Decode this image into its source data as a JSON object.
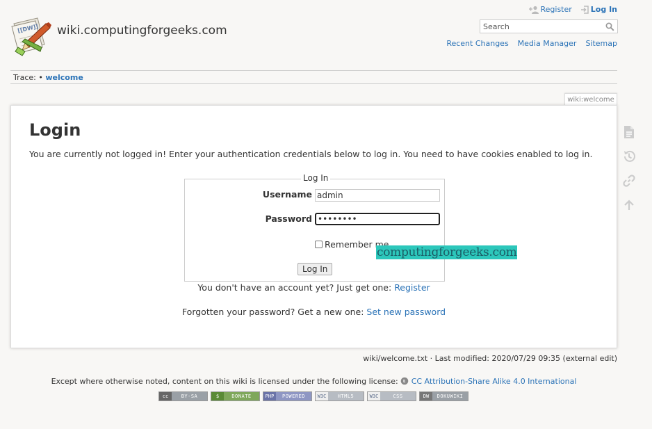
{
  "header": {
    "site_title": "wiki.computingforgeeks.com",
    "logo_text": "[[DW]]"
  },
  "user_tools": {
    "register": "Register",
    "login": "Log In"
  },
  "search": {
    "placeholder": "Search",
    "value": ""
  },
  "site_tools": {
    "recent_changes": "Recent Changes",
    "media_manager": "Media Manager",
    "sitemap": "Sitemap"
  },
  "breadcrumbs": {
    "label": "Trace:",
    "separator": "•",
    "items": [
      "welcome"
    ]
  },
  "page_id": "wiki:welcome",
  "page": {
    "title": "Login",
    "intro": "You are currently not logged in! Enter your authentication credentials below to log in. You need to have cookies enabled to log in."
  },
  "login_form": {
    "legend": "Log In",
    "username_label": "Username",
    "username_value": "admin",
    "password_label": "Password",
    "password_value": "********",
    "remember_label": "Remember me",
    "remember_checked": false,
    "submit_label": "Log In"
  },
  "watermark": "computingforgeeks.com",
  "no_account": {
    "text": "You don't have an account yet? Just get one:",
    "link": "Register"
  },
  "forgot": {
    "text": "Forgotten your password? Get a new one:",
    "link": "Set new password"
  },
  "page_tools": [
    "show-page-icon",
    "old-revisions-icon",
    "backlinks-icon",
    "back-to-top-icon"
  ],
  "doc_info": "wiki/welcome.txt · Last modified: 2020/07/29 09:35 (external edit)",
  "license": {
    "text": "Except where otherwise noted, content on this wiki is licensed under the following license:",
    "link": "CC Attribution-Share Alike 4.0 International"
  },
  "badges": [
    {
      "left": "cc",
      "right": "BY-SA",
      "color": "#9aa0a6"
    },
    {
      "left": "$",
      "right": "DONATE",
      "color": "#7fa75b"
    },
    {
      "left": "PHP",
      "right": "POWERED",
      "color": "#8e96c3"
    },
    {
      "left": "W3C",
      "right": "HTML5",
      "color": "#b7bcc3"
    },
    {
      "left": "W3C",
      "right": "CSS",
      "color": "#b7bcc3"
    },
    {
      "left": "DW",
      "right": "DOKUWIKI",
      "color": "#9aa0a6"
    }
  ],
  "colors": {
    "link": "#2b73b7",
    "watermark_bg": "#2cc7bb",
    "watermark_fg": "#1b5c65"
  }
}
